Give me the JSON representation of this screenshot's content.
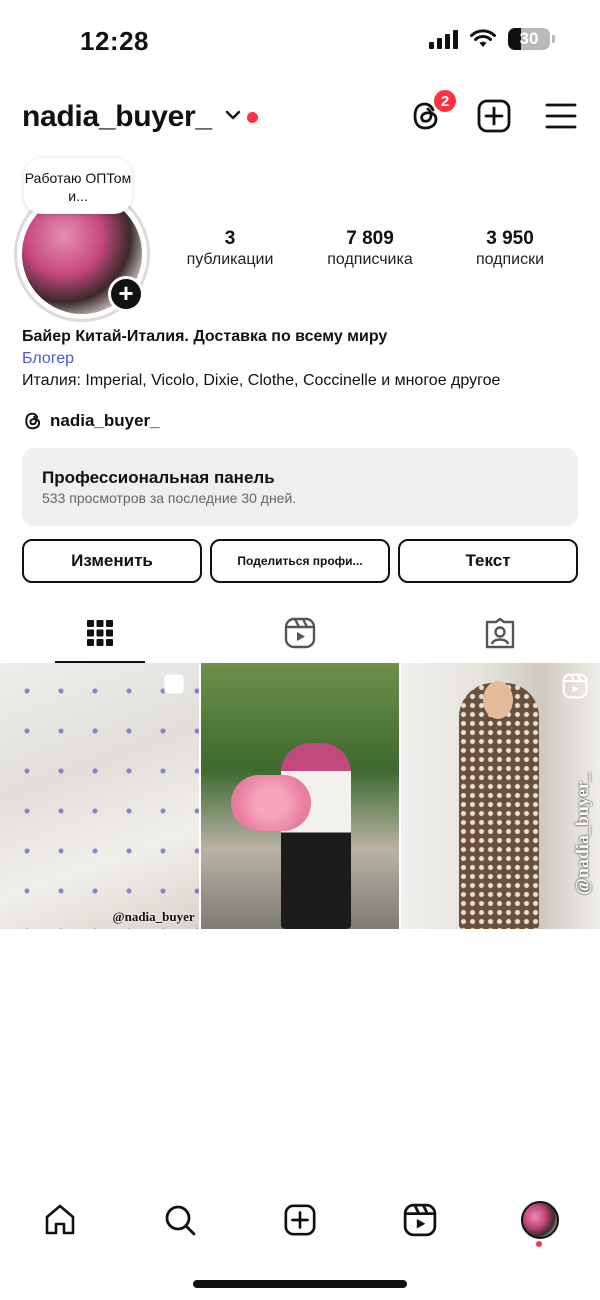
{
  "status_bar": {
    "time": "12:28",
    "battery_level": "30"
  },
  "header": {
    "username": "nadia_buyer_",
    "threads_badge": "2",
    "icons": [
      "threads-icon",
      "add-post-icon",
      "menu-icon"
    ]
  },
  "profile": {
    "note": "Работаю ОПТом и...",
    "stats": [
      {
        "value": "3",
        "label": "публикации"
      },
      {
        "value": "7 809",
        "label": "подписчика"
      },
      {
        "value": "3 950",
        "label": "подписки"
      }
    ],
    "bio_name": "Байер Китай-Италия. Доставка по всему миру",
    "category": "Блогер",
    "bio_text": "Италия: Imperial, Vicolo, Dixie, Clothe, Coccinelle и многое другое",
    "threads_handle": "nadia_buyer_"
  },
  "pro_panel": {
    "title": "Профессиональная панель",
    "subtitle": "533 просмотров за последние 30 дней."
  },
  "actions": {
    "edit": "Изменить",
    "share": "Поделиться профи...",
    "text": "Текст"
  },
  "posts": [
    {
      "watermark": "@nadia_buyer",
      "type": "carousel"
    },
    {
      "watermark": "",
      "type": "photo"
    },
    {
      "watermark": "@nadia_buyer_",
      "type": "reel"
    }
  ],
  "colors": {
    "accent_red": "#ff3040",
    "link_blue": "#4a58d6",
    "panel_bg": "#efefef"
  }
}
